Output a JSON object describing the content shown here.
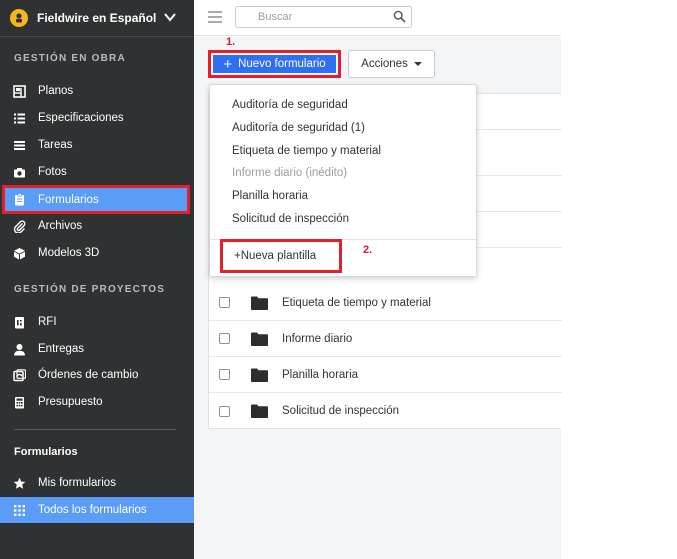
{
  "brand": {
    "name": "Fieldwire en Español"
  },
  "sidebar": {
    "section_obra": "GESTIÓN EN OBRA",
    "obra_items": [
      {
        "label": "Planos",
        "icon": "blueprint-icon"
      },
      {
        "label": "Especificaciones",
        "icon": "list-icon"
      },
      {
        "label": "Tareas",
        "icon": "tasks-icon"
      },
      {
        "label": "Fotos",
        "icon": "camera-icon"
      },
      {
        "label": "Formularios",
        "icon": "clipboard-icon"
      },
      {
        "label": "Archivos",
        "icon": "paperclip-icon"
      },
      {
        "label": "Modelos 3D",
        "icon": "cube-icon"
      }
    ],
    "section_proyectos": "GESTIÓN DE PROYECTOS",
    "proyecto_items": [
      {
        "label": "RFI",
        "icon": "rfi-icon"
      },
      {
        "label": "Entregas",
        "icon": "user-icon"
      },
      {
        "label": "Órdenes de cambio",
        "icon": "change-order-icon"
      },
      {
        "label": "Presupuesto",
        "icon": "calculator-icon"
      }
    ],
    "forms_heading": "Formularios",
    "forms_items": [
      {
        "label": "Mis formularios",
        "icon": "star-icon"
      },
      {
        "label": "Todos los formularios",
        "icon": "grid-icon"
      }
    ]
  },
  "topbar": {
    "search_placeholder": "Buscar"
  },
  "toolbar": {
    "new_form_label": "Nuevo formulario",
    "actions_label": "Acciones",
    "step1": "1.",
    "step2": "2."
  },
  "dropdown": {
    "items": [
      "Auditoría de seguridad",
      "Auditoría de seguridad (1)",
      "Etiqueta de tiempo y material",
      "Informe diario (inédito)",
      "Planilla horaria",
      "Solicitud de inspección"
    ],
    "new_template": "+Nueva plantilla"
  },
  "table": {
    "rows": [
      "Etiqueta de tiempo y material",
      "Informe diario",
      "Planilla horaria",
      "Solicitud de inspección"
    ]
  },
  "colors": {
    "sidebar_bg": "#2f3133",
    "active": "#5b9cf6",
    "primary": "#2f6ff2",
    "highlight": "#e0202a"
  }
}
